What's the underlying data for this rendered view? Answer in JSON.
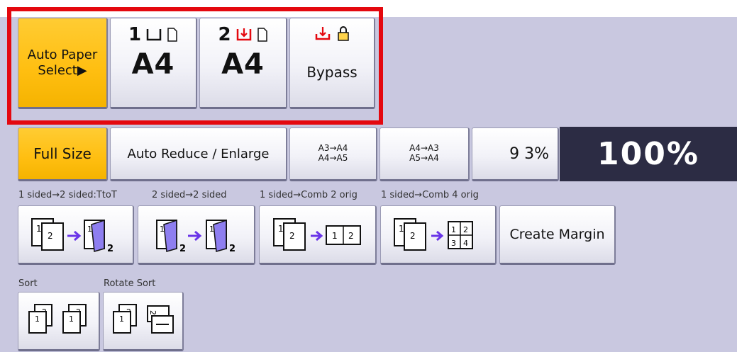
{
  "paper": {
    "auto_paper_select": "Auto Paper\nSelect▶",
    "tray1": {
      "number": "1",
      "size": "A4"
    },
    "tray2": {
      "number": "2",
      "size": "A4"
    },
    "bypass": {
      "label": "Bypass"
    }
  },
  "ratio": {
    "full_size": "Full Size",
    "auto_reduce_enlarge": "Auto Reduce / Enlarge",
    "preset1_line1": "A3→A4",
    "preset1_line2": "A4→A5",
    "preset2_line1": "A4→A3",
    "preset2_line2": "A5→A4",
    "preset_93": "9 3%",
    "current": "100%"
  },
  "duplex": {
    "labels": [
      "1 sided→2 sided:TtoT",
      "2 sided→2 sided",
      "1 sided→Comb 2 orig",
      "1 sided→Comb 4 orig"
    ],
    "create_margin": "Create Margin"
  },
  "finishing": {
    "sort_label": "Sort",
    "rotate_sort_label": "Rotate Sort"
  },
  "colors": {
    "selected": "#ffbe10",
    "highlight_frame": "#e4080f",
    "arrow": "#6a35e8",
    "tray_red": "#e4080f"
  }
}
